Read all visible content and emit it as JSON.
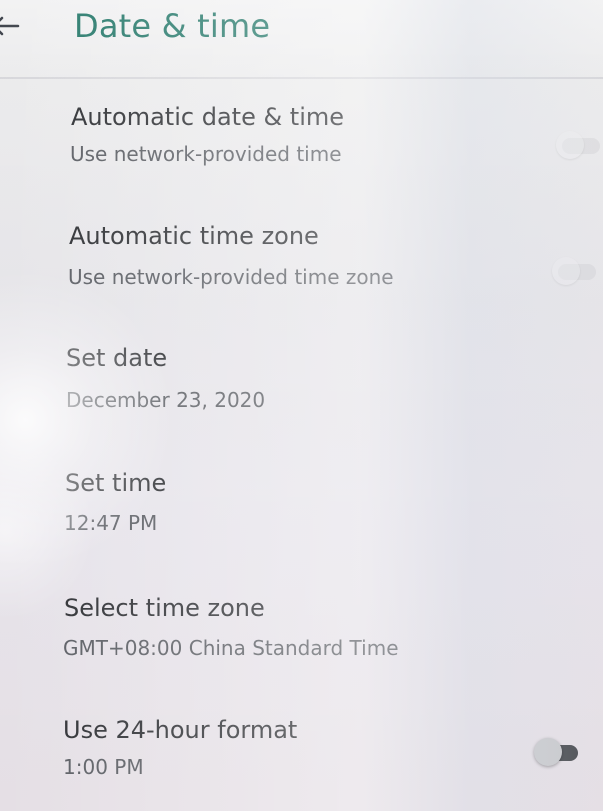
{
  "header": {
    "title": "Date & time",
    "back_icon": "arrow-back-icon"
  },
  "settings": {
    "automatic_date_time": {
      "title": "Automatic date & time",
      "summary": "Use network-provided time",
      "toggle_on": false
    },
    "automatic_time_zone": {
      "title": "Automatic time zone",
      "summary": "Use network-provided time zone",
      "toggle_on": false
    },
    "set_date": {
      "title": "Set date",
      "summary": "December 23, 2020"
    },
    "set_time": {
      "title": "Set time",
      "summary": "12:47 PM"
    },
    "select_time_zone": {
      "title": "Select time zone",
      "summary": "GMT+08:00 China Standard Time"
    },
    "use_24_hour_format": {
      "title": "Use 24-hour format",
      "summary": "1:00 PM",
      "toggle_on": false
    }
  },
  "colors": {
    "title_accent": "#287a6c",
    "primary_text": "#2d2f33",
    "secondary_text": "#5b5e64",
    "background": "#ececed"
  }
}
